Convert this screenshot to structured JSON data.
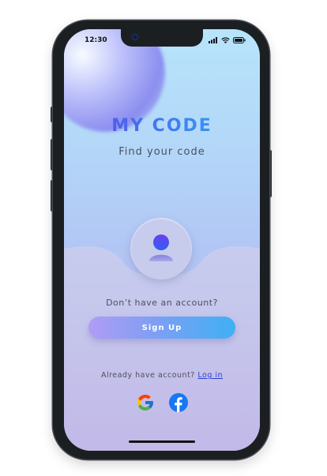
{
  "status_bar": {
    "time": "12:30",
    "icons": [
      "signal-icon",
      "wifi-icon",
      "battery-icon"
    ]
  },
  "app": {
    "title": "MY CODE",
    "tagline": "Find your code"
  },
  "colors": {
    "brand_gradient_start": "#5a44e6",
    "brand_gradient_end": "#2ab0f4",
    "button_gradient_start": "#b09cf5",
    "button_gradient_end": "#3fb0f3",
    "link": "#2d3fd6"
  },
  "signup_section": {
    "prompt": "Don’t have an account?",
    "button_label": "Sign Up"
  },
  "login_section": {
    "prompt": "Already have account?",
    "link_label": "Log in"
  },
  "social": {
    "providers": [
      "google-icon",
      "facebook-icon"
    ]
  }
}
